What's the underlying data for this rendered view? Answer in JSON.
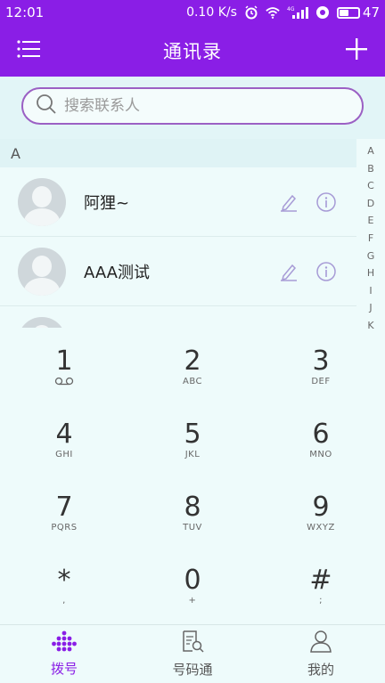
{
  "status_bar": {
    "time": "12:01",
    "speed": "0.10 K/s",
    "network": "4G",
    "battery": "47"
  },
  "app_bar": {
    "title": "通讯录",
    "menu_icon": "menu-icon",
    "add_icon": "plus-icon"
  },
  "search": {
    "placeholder": "搜索联系人"
  },
  "contacts": {
    "section": "A",
    "items": [
      {
        "name": "阿狸~"
      },
      {
        "name": "AAA测试"
      },
      {
        "name": ""
      }
    ]
  },
  "index_letters": [
    "A",
    "B",
    "C",
    "D",
    "E",
    "F",
    "G",
    "H",
    "I",
    "J",
    "K"
  ],
  "dialpad": {
    "keys": [
      {
        "digit": "1",
        "sub": ""
      },
      {
        "digit": "2",
        "sub": "ABC"
      },
      {
        "digit": "3",
        "sub": "DEF"
      },
      {
        "digit": "4",
        "sub": "GHI"
      },
      {
        "digit": "5",
        "sub": "JKL"
      },
      {
        "digit": "6",
        "sub": "MNO"
      },
      {
        "digit": "7",
        "sub": "PQRS"
      },
      {
        "digit": "8",
        "sub": "TUV"
      },
      {
        "digit": "9",
        "sub": "WXYZ"
      },
      {
        "digit": "*",
        "sub": ","
      },
      {
        "digit": "0",
        "sub": "+"
      },
      {
        "digit": "#",
        "sub": ";"
      }
    ]
  },
  "bottom_nav": {
    "items": [
      {
        "label": "拨号",
        "icon": "dialpad-icon",
        "active": true
      },
      {
        "label": "号码通",
        "icon": "number-lookup-icon",
        "active": false
      },
      {
        "label": "我的",
        "icon": "profile-icon",
        "active": false
      }
    ]
  },
  "colors": {
    "primary": "#8a1ee6",
    "background": "#eefbfb"
  }
}
